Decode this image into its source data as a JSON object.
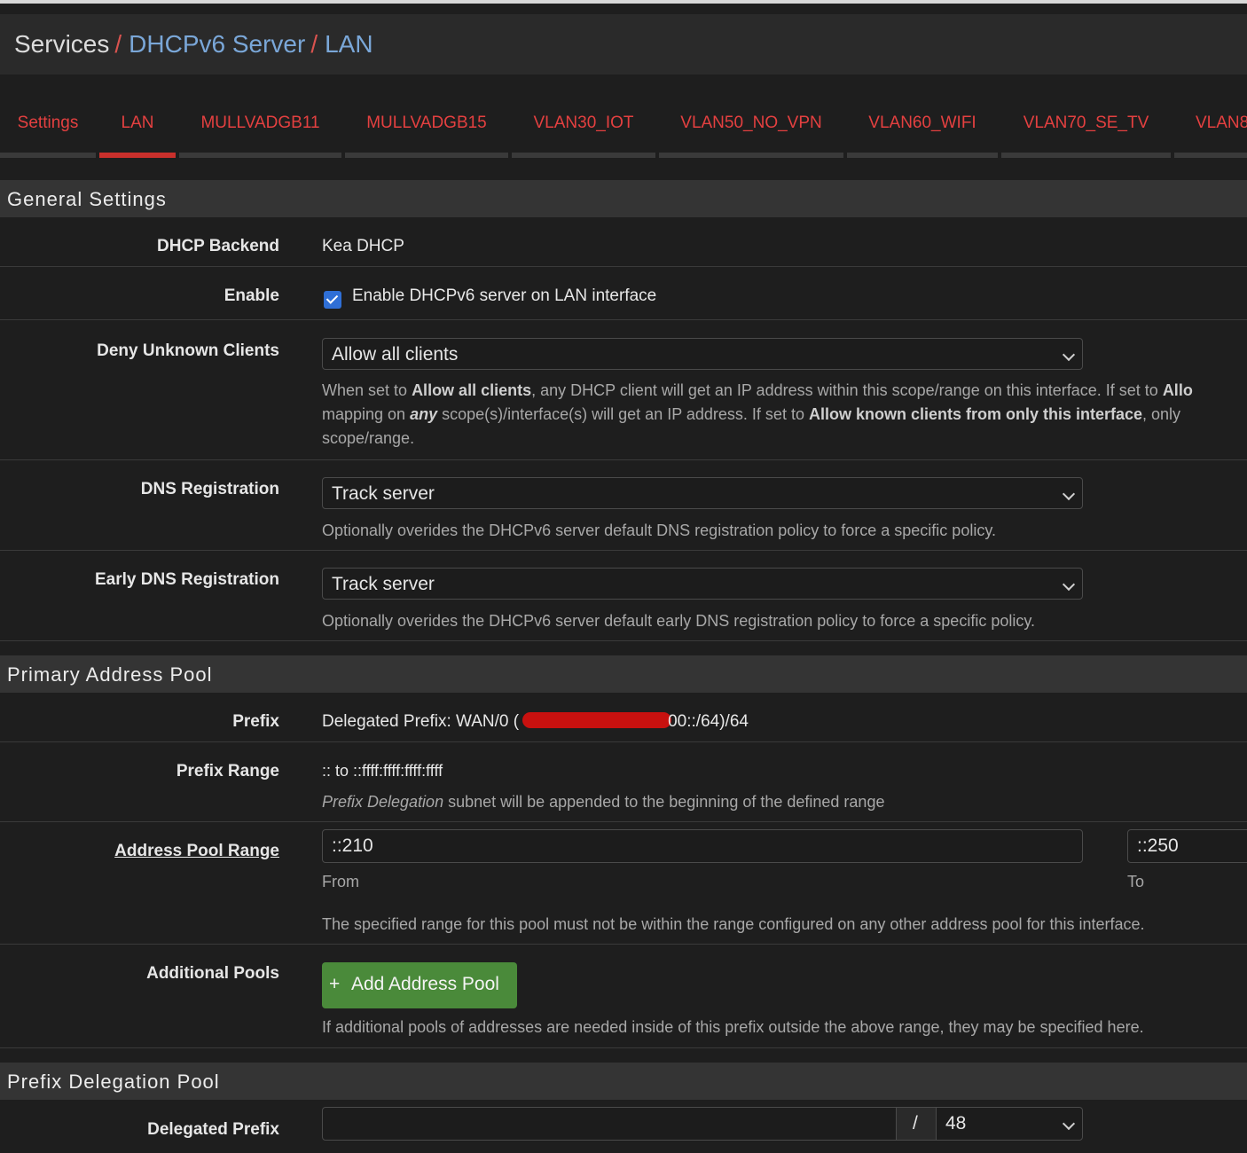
{
  "breadcrumb": {
    "root": "Services",
    "sep1": "/",
    "level2": "DHCPv6 Server",
    "sep2": "/",
    "level3": "LAN"
  },
  "tabs": [
    {
      "label": "Settings"
    },
    {
      "label": "LAN"
    },
    {
      "label": "MULLVADGB11"
    },
    {
      "label": "MULLVADGB15"
    },
    {
      "label": "VLAN30_IOT"
    },
    {
      "label": "VLAN50_NO_VPN"
    },
    {
      "label": "VLAN60_WIFI"
    },
    {
      "label": "VLAN70_SE_TV"
    },
    {
      "label": "VLAN8"
    }
  ],
  "general": {
    "title": "General Settings",
    "backend_label": "DHCP Backend",
    "backend_value": "Kea DHCP",
    "enable_label": "Enable",
    "enable_text": "Enable DHCPv6 server on LAN interface",
    "deny_label": "Deny Unknown Clients",
    "deny_value": "Allow all clients",
    "deny_help": {
      "p1": "When set to ",
      "b1": "Allow all clients",
      "p2": ", any DHCP client will get an IP address within this scope/range on this interface. If set to ",
      "b2": "Allo",
      "p3": "mapping on ",
      "b3": "any",
      "p4": " scope(s)/interface(s) will get an IP address. If set to ",
      "b4": "Allow known clients from only this interface",
      "p5": ", only ",
      "p6": "scope/range."
    },
    "dns_label": "DNS Registration",
    "dns_value": "Track server",
    "dns_help": "Optionally overides the DHCPv6 server default DNS registration policy to force a specific policy.",
    "early_label": "Early DNS Registration",
    "early_value": "Track server",
    "early_help": "Optionally overides the DHCPv6 server default early DNS registration policy to force a specific policy."
  },
  "primary": {
    "title": "Primary Address Pool",
    "prefix_label": "Prefix",
    "prefix_before": "Delegated Prefix: WAN/0 (",
    "prefix_after": "00::/64)/64",
    "range_label": "Prefix Range",
    "range_value": ":: to ::ffff:ffff:ffff:ffff",
    "range_help_italic": "Prefix Delegation",
    "range_help_rest": " subnet will be appended to the beginning of the defined range",
    "pool_label": "Address Pool Range",
    "pool_from": "::210",
    "pool_to": "::250",
    "from_caption": "From",
    "to_caption": "To",
    "pool_help": "The specified range for this pool must not be within the range configured on any other address pool for this interface.",
    "additional_label": "Additional Pools",
    "add_button": "Add Address Pool",
    "add_plus": "+",
    "additional_help": "If additional pools of addresses are needed inside of this prefix outside the above range, they may be specified here."
  },
  "pd": {
    "title": "Prefix Delegation Pool",
    "delegated_label": "Delegated Prefix",
    "slash": "/",
    "prefix_len": "48"
  }
}
